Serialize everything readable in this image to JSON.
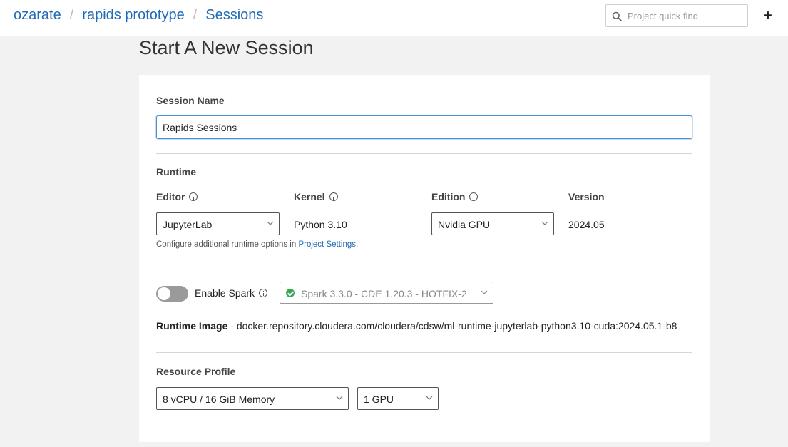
{
  "breadcrumb": {
    "user": "ozarate",
    "project": "rapids prototype",
    "page": "Sessions",
    "separator": "/"
  },
  "search": {
    "placeholder": "Project quick find"
  },
  "header": {
    "add_label": "+"
  },
  "page_title": "Start A New Session",
  "session_name": {
    "label": "Session Name",
    "value": "Rapids Sessions"
  },
  "runtime": {
    "section_label": "Runtime",
    "editor": {
      "label": "Editor",
      "value": "JupyterLab"
    },
    "kernel": {
      "label": "Kernel",
      "value": "Python 3.10"
    },
    "edition": {
      "label": "Edition",
      "value": "Nvidia GPU"
    },
    "version": {
      "label": "Version",
      "value": "2024.05"
    },
    "hint_prefix": "Configure additional runtime options in ",
    "hint_link": "Project Settings",
    "hint_suffix": "."
  },
  "spark": {
    "label": "Enable Spark",
    "enabled": false,
    "value": "Spark 3.3.0 - CDE 1.20.3 - HOTFIX-2"
  },
  "runtime_image": {
    "label": "Runtime Image",
    "separator": " - ",
    "value": "docker.repository.cloudera.com/cloudera/cdsw/ml-runtime-jupyterlab-python3.10-cuda:2024.05.1-b8"
  },
  "resource_profile": {
    "label": "Resource Profile",
    "profile": "8 vCPU / 16 GiB Memory",
    "gpu": "1 GPU"
  },
  "colors": {
    "link": "#1f6bb5",
    "focus_border": "#4a90d9",
    "spark_check": "#35a853",
    "toggle_off": "#9a9a9a"
  }
}
